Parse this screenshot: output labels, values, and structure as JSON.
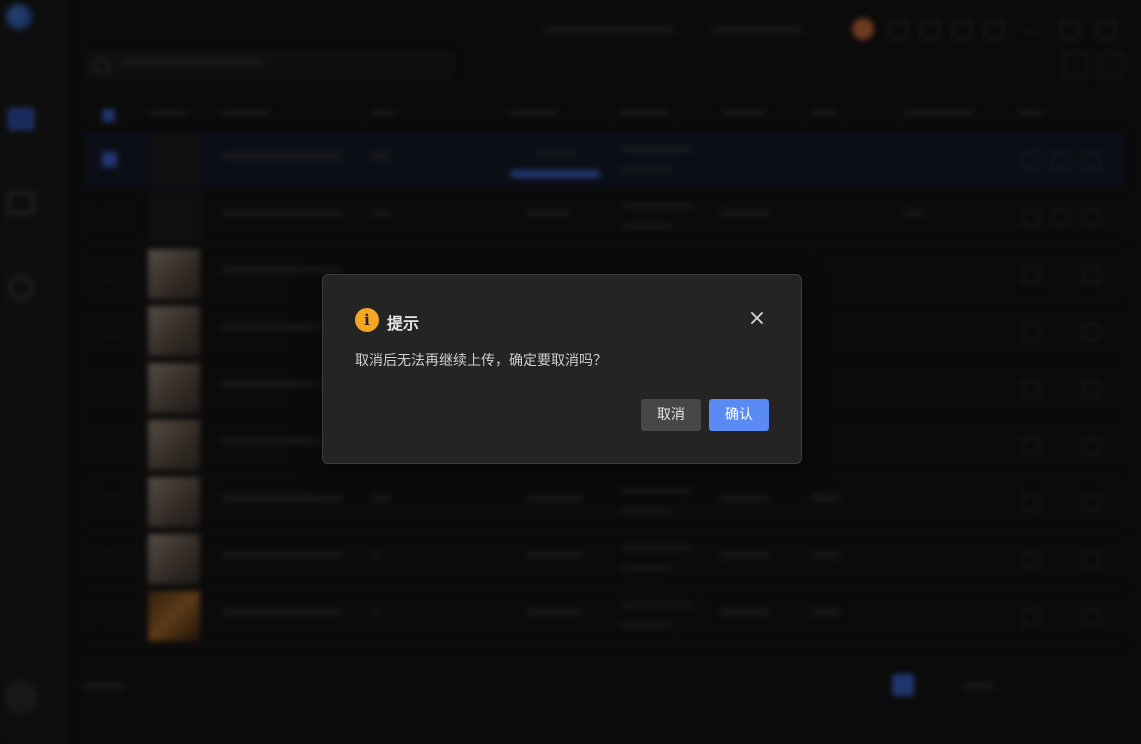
{
  "dialog": {
    "title": "提示",
    "message": "取消后无法再继续上传，确定要取消吗？",
    "cancel_label": "取消",
    "confirm_label": "确认",
    "icon": "warning-icon",
    "colors": {
      "warning": "#f5a623",
      "confirm_bg": "#5a8bf5",
      "cancel_bg": "#474747",
      "dialog_bg": "#242424"
    }
  },
  "colors": {
    "accent": "#3d63c9",
    "background": "#141414"
  }
}
